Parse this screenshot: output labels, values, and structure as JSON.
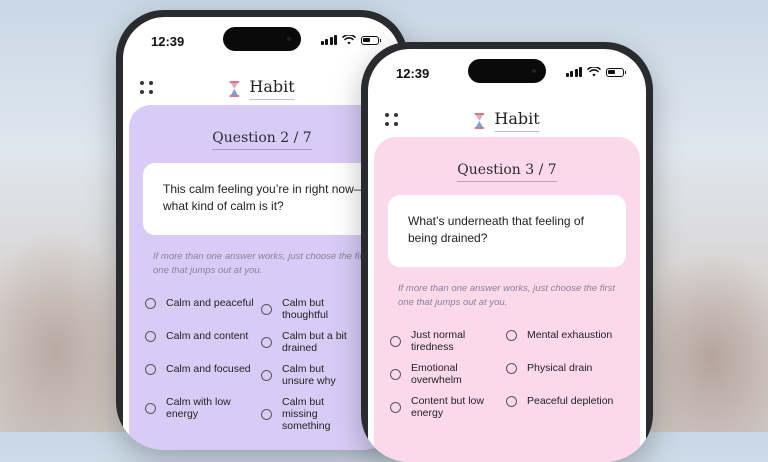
{
  "phones": [
    {
      "status_time": "12:39",
      "brand": "Habit",
      "question_label": "Question 2 / 7",
      "question_text": "This calm feeling you’re in right now—what kind of calm is it?",
      "hint": "If more than one answer works, just choose the first one that jumps out at you.",
      "options_left": [
        "Calm and peaceful",
        "Calm and content",
        "Calm and focused",
        "Calm with low energy"
      ],
      "options_right": [
        "Calm but thoughtful",
        "Calm but a bit drained",
        "Calm but unsure why",
        "Calm but missing something"
      ],
      "card_color": "#d8ccf6"
    },
    {
      "status_time": "12:39",
      "brand": "Habit",
      "question_label": "Question 3 / 7",
      "question_text": "What’s underneath that feeling of being drained?",
      "hint": "If more than one answer works, just choose the first one that jumps out at you.",
      "options_left": [
        "Just normal tiredness",
        "Emotional overwhelm",
        "Content but low energy"
      ],
      "options_right": [
        "Mental exhaustion",
        "Physical drain",
        "Peaceful depletion"
      ],
      "card_color": "#fbd8ea"
    }
  ],
  "icons": {
    "menu": "grid-dots-icon",
    "brand": "hourglass-icon",
    "signal": "signal-icon",
    "wifi": "wifi-icon",
    "battery": "battery-icon",
    "radio": "radio-circle-icon"
  }
}
